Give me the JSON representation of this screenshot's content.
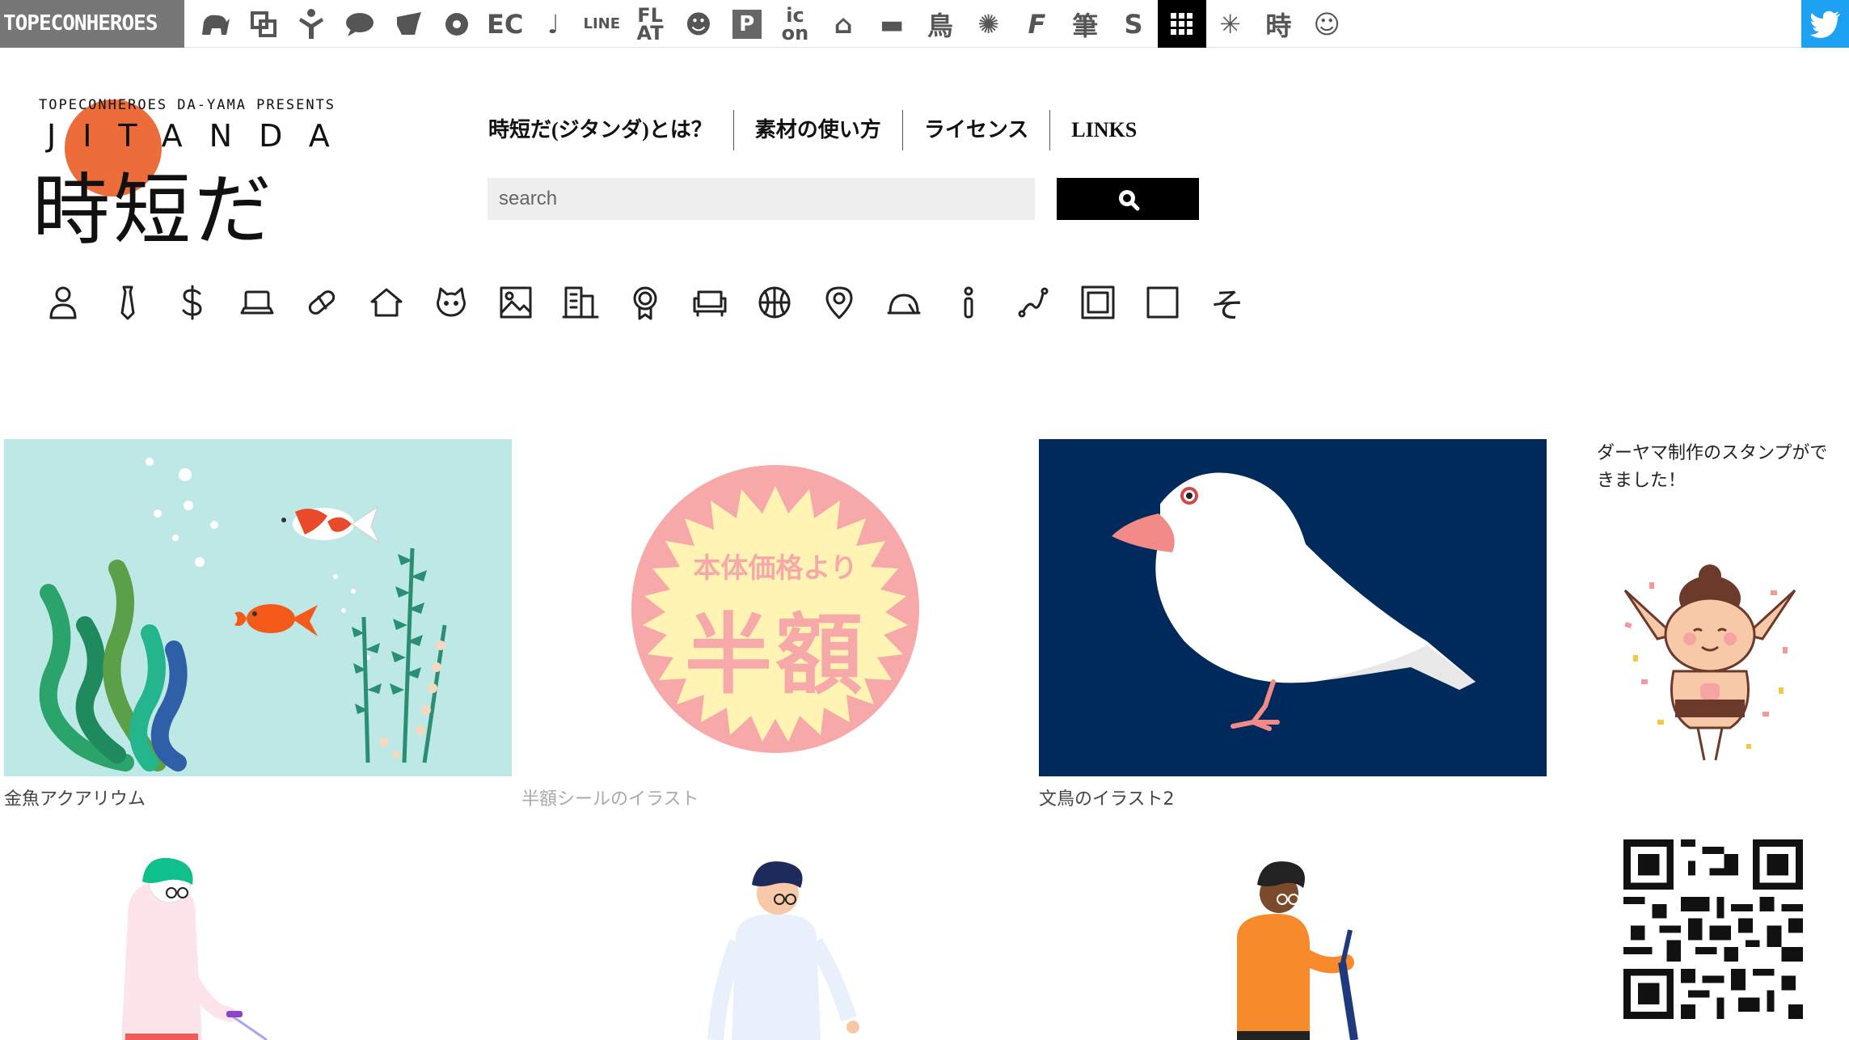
{
  "topbar": {
    "brand": "TOPECONHEROES",
    "sites": [
      {
        "icon": "elephant-icon",
        "text": ""
      },
      {
        "icon": "copy-icon",
        "text": ""
      },
      {
        "icon": "person-icon",
        "text": ""
      },
      {
        "icon": "speech-bubble-icon",
        "text": ""
      },
      {
        "icon": "bird-icon",
        "text": ""
      },
      {
        "icon": "flower-icon",
        "text": ""
      },
      {
        "icon": "ec-icon",
        "text": "EC"
      },
      {
        "icon": "music-note-icon",
        "text": "♩"
      },
      {
        "icon": "line-icon",
        "text": "LINE"
      },
      {
        "icon": "flat-icon",
        "text": "FL AT"
      },
      {
        "icon": "smile-icon",
        "text": "☻"
      },
      {
        "icon": "parking-icon",
        "text": "P"
      },
      {
        "icon": "icon-on-icon",
        "text": "ic on"
      },
      {
        "icon": "building-icon",
        "text": "⌂"
      },
      {
        "icon": "bench-icon",
        "text": "▬"
      },
      {
        "icon": "tori-icon",
        "text": "鳥"
      },
      {
        "icon": "pattern-icon",
        "text": "✺"
      },
      {
        "icon": "f-icon",
        "text": "F"
      },
      {
        "icon": "brush-icon",
        "text": "筆"
      },
      {
        "icon": "s-icon",
        "text": "S"
      },
      {
        "icon": "grid-icon",
        "text": ""
      },
      {
        "icon": "burst-icon",
        "text": "✳"
      },
      {
        "icon": "toki-icon",
        "text": "時"
      },
      {
        "icon": "face-icon",
        "text": "☺"
      }
    ],
    "twitter_icon": "twitter-icon"
  },
  "logo": {
    "presents": "TOPECONHEROES DA-YAMA PRESENTS",
    "jitanda": "JITANDA",
    "kanji": "時短だ"
  },
  "nav": [
    {
      "label": "時短だ(ジタンダ)とは？"
    },
    {
      "label": "素材の使い方"
    },
    {
      "label": "ライセンス"
    },
    {
      "label": "LINKS"
    }
  ],
  "search": {
    "placeholder": "search"
  },
  "categories": [
    "person-icon",
    "tie-icon",
    "dollar-icon",
    "laptop-icon",
    "pill-icon",
    "house-icon",
    "cat-icon",
    "image-icon",
    "building-icon",
    "medal-icon",
    "sofa-icon",
    "basketball-icon",
    "map-pin-icon",
    "sunrise-icon",
    "info-icon",
    "route-icon",
    "frame-icon",
    "square-icon",
    "other-icon"
  ],
  "category_other_label": "そ",
  "cards": [
    {
      "caption": "金魚アクアリウム"
    },
    {
      "caption": "半額シールのイラスト",
      "sticker_line1": "本体価格より",
      "sticker_line2": "半額"
    },
    {
      "caption": "文鳥のイラスト2"
    }
  ],
  "sidebar": {
    "text": "ダーヤマ制作のスタンプができました！"
  },
  "colors": {
    "accent": "#ec6c3a",
    "aquarium_bg": "#bde8e6",
    "bird_bg": "#002a5c",
    "sticker_pink": "#f7a8a8",
    "sticker_yellow": "#fff4b3",
    "twitter": "#1da1f2"
  }
}
